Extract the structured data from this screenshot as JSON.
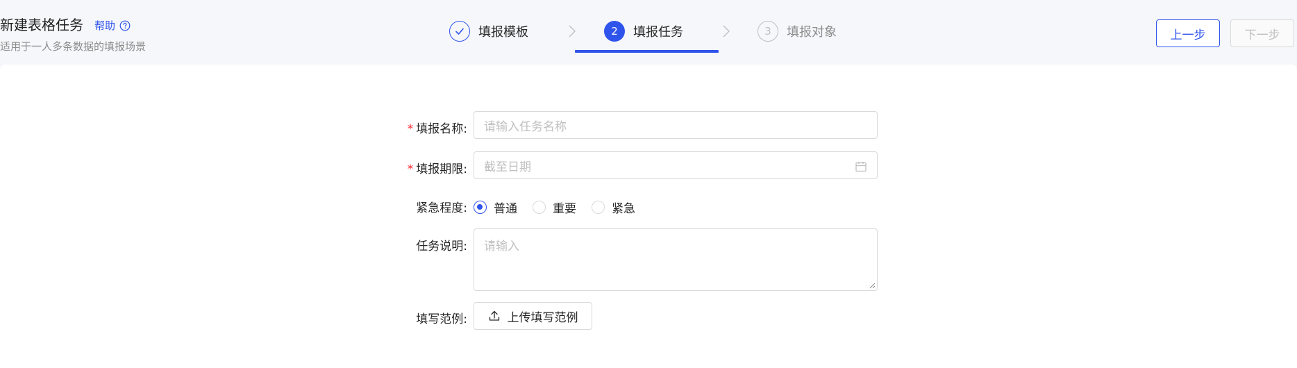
{
  "header": {
    "title": "新建表格任务",
    "help_label": "帮助",
    "subtitle": "适用于一人多条数据的填报场景"
  },
  "steps": [
    {
      "number": "1",
      "label": "填报模板",
      "status": "done"
    },
    {
      "number": "2",
      "label": "填报任务",
      "status": "active"
    },
    {
      "number": "3",
      "label": "填报对象",
      "status": "wait"
    }
  ],
  "actions": {
    "prev_label": "上一步",
    "next_label": "下一步"
  },
  "form": {
    "name": {
      "label": "填报名称:",
      "required": true,
      "placeholder": "请输入任务名称",
      "value": ""
    },
    "deadline": {
      "label": "填报期限:",
      "required": true,
      "placeholder": "截至日期",
      "value": ""
    },
    "urgency": {
      "label": "紧急程度:",
      "options": [
        "普通",
        "重要",
        "紧急"
      ],
      "selected": "普通"
    },
    "description": {
      "label": "任务说明:",
      "placeholder": "请输入",
      "value": ""
    },
    "example": {
      "label": "填写范例:",
      "upload_label": "上传填写范例"
    }
  },
  "colors": {
    "primary": "#2f54eb",
    "required": "#f5222d",
    "placeholder": "#bfbfbf",
    "border": "#d9d9d9",
    "page_bg": "#f6f7fb"
  }
}
